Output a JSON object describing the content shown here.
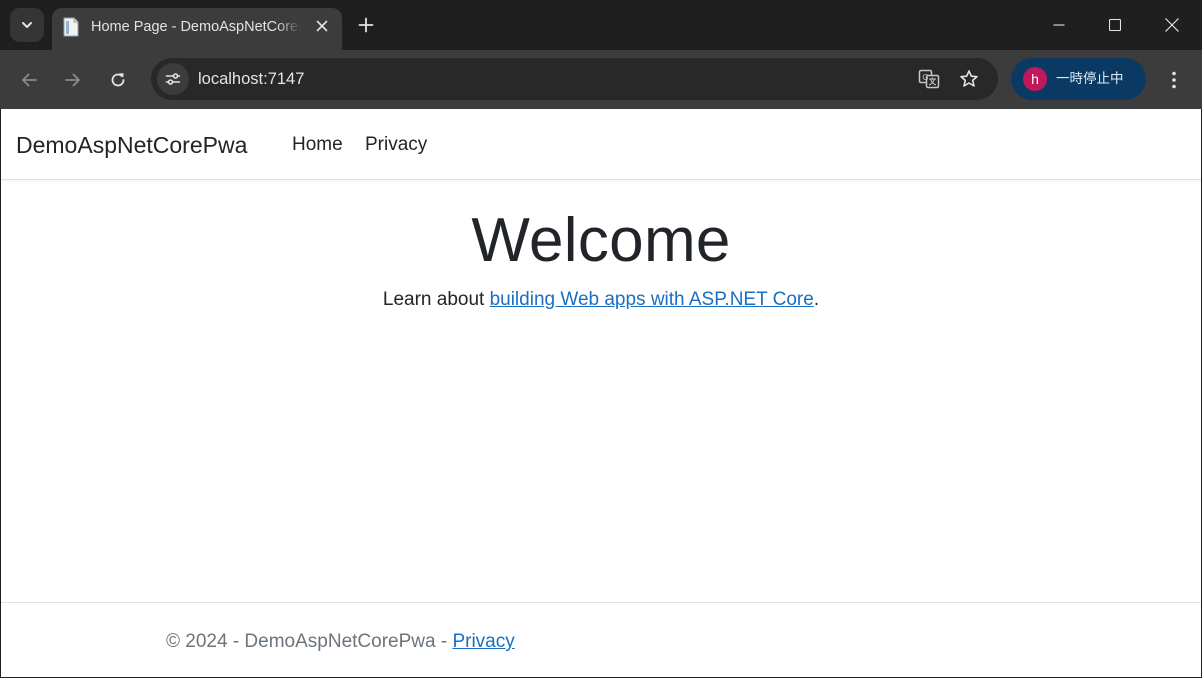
{
  "browser": {
    "tab": {
      "title": "Home Page - DemoAspNetCorePwa"
    },
    "url": "localhost:7147",
    "profile": {
      "initial": "h",
      "status": "一時停止中",
      "avatar_color": "#c2185b"
    },
    "icons": [
      "tab-search-icon",
      "favicon-icon",
      "tab-close-icon",
      "new-tab-icon",
      "minimize-icon",
      "maximize-icon",
      "window-close-icon",
      "back-icon",
      "forward-icon",
      "reload-icon",
      "site-info-icon",
      "translate-icon",
      "bookmark-star-icon",
      "more-menu-icon"
    ]
  },
  "page": {
    "brand": "DemoAspNetCorePwa",
    "nav": {
      "home": "Home",
      "privacy": "Privacy"
    },
    "heading": "Welcome",
    "intro_prefix": "Learn about ",
    "intro_link": "building Web apps with ASP.NET Core",
    "intro_suffix": ".",
    "footer_text": "© 2024 - DemoAspNetCorePwa - ",
    "footer_link": "Privacy",
    "link_color": "#1b6ec2"
  }
}
